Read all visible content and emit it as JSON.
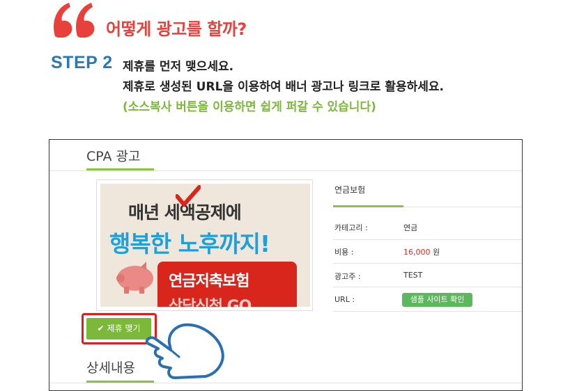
{
  "heading": {
    "title": "어떻게 광고를 할까?",
    "step": "STEP 2",
    "lines": [
      "제휴를 먼저 맺으세요.",
      "제휴로 생성된 URL을 이용하여 배너 광고나 링크로 활용하세요."
    ],
    "note": "(소스복사 버튼을 이용하면 쉽게 퍼갈 수 있습니다)"
  },
  "panel": {
    "section_title": "CPA 광고",
    "detail_title": "상세내용",
    "banner": {
      "line1": "매년 세액공제에",
      "line2": "행복한 노후까지!",
      "line3": "연금저축보험",
      "line4": "상담신청 GO"
    },
    "info": {
      "title": "연금보험",
      "rows": [
        {
          "label": "카테고리 :",
          "value": "연금"
        },
        {
          "label": "비용 :",
          "value": "16,000",
          "unit": "원"
        },
        {
          "label": "광고주 :",
          "value": "TEST"
        },
        {
          "label": "URL :",
          "button": "샘플 사이트 확인"
        }
      ]
    },
    "join_button": "제휴 맺기",
    "join_check": "✔"
  },
  "colors": {
    "accent_red": "#e8413b",
    "step_blue": "#2a78b8",
    "green": "#7cb83a",
    "price_red": "#e1261c"
  }
}
